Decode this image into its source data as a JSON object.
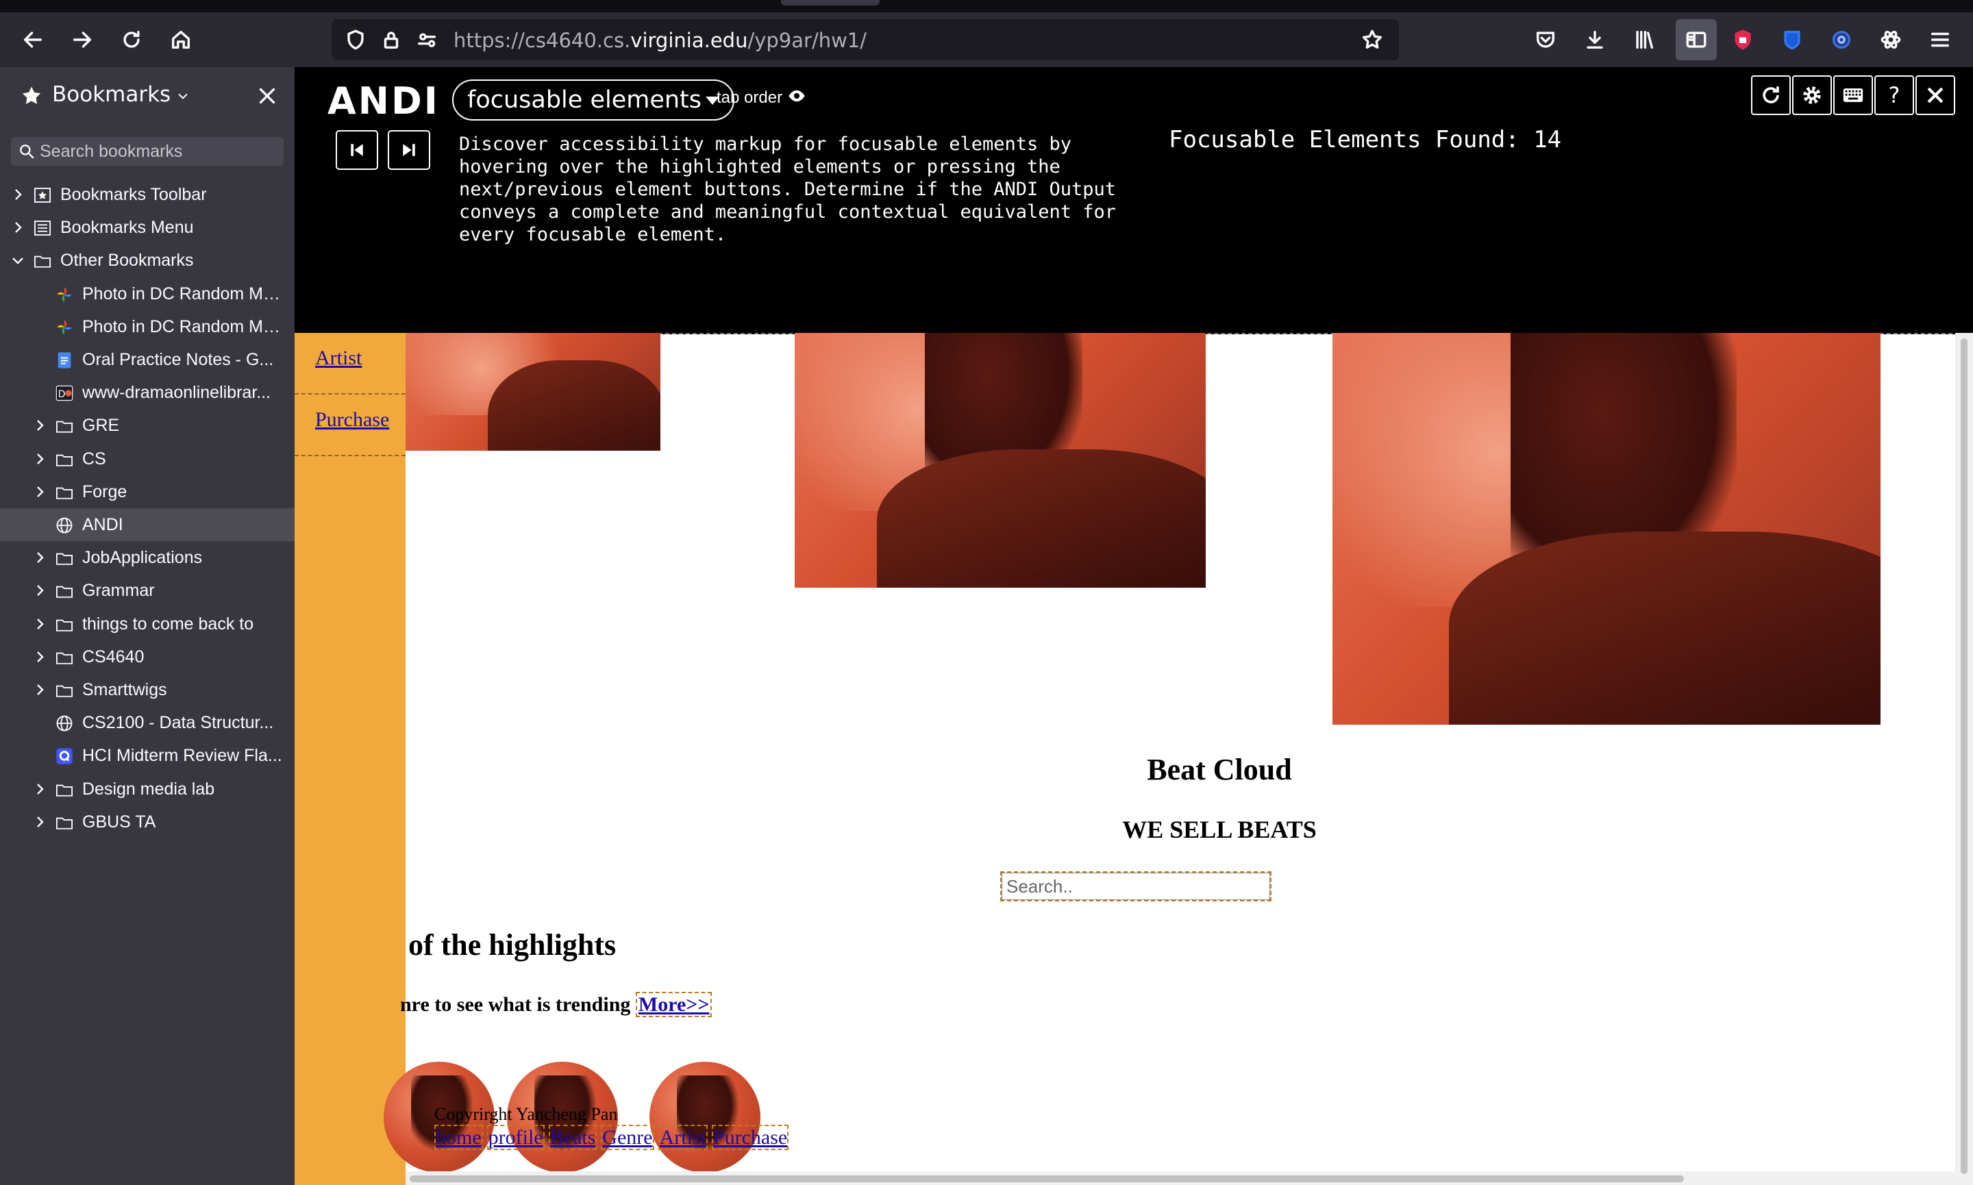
{
  "browser": {
    "url_prefix": "https://cs4640.cs.",
    "url_domain": "virginia.edu",
    "url_path": "/yp9ar/hw1/"
  },
  "sidebar": {
    "title": "Bookmarks",
    "search_placeholder": "Search bookmarks",
    "items": [
      {
        "label": "Bookmarks Toolbar",
        "icon": "star-folder-icon",
        "level": 0,
        "twisty": "right"
      },
      {
        "label": "Bookmarks Menu",
        "icon": "menu-folder-icon",
        "level": 0,
        "twisty": "right"
      },
      {
        "label": "Other Bookmarks",
        "icon": "folder-icon",
        "level": 0,
        "twisty": "down"
      },
      {
        "label": "Photo in DC Random Mo...",
        "icon": "google-photos-icon",
        "level": 1
      },
      {
        "label": "Photo in DC Random Mo...",
        "icon": "google-photos-icon",
        "level": 1
      },
      {
        "label": "Oral Practice Notes - G...",
        "icon": "google-docs-icon",
        "level": 1
      },
      {
        "label": "www-dramaonlinelibrar...",
        "icon": "drama-site-icon",
        "level": 1
      },
      {
        "label": "GRE",
        "icon": "folder-icon",
        "level": 1,
        "twisty": "right"
      },
      {
        "label": "CS",
        "icon": "folder-icon",
        "level": 1,
        "twisty": "right"
      },
      {
        "label": "Forge",
        "icon": "folder-icon",
        "level": 1,
        "twisty": "right"
      },
      {
        "label": "ANDI",
        "icon": "globe-icon",
        "level": 1,
        "selected": true
      },
      {
        "label": "JobApplications",
        "icon": "folder-icon",
        "level": 1,
        "twisty": "right"
      },
      {
        "label": "Grammar",
        "icon": "folder-icon",
        "level": 1,
        "twisty": "right"
      },
      {
        "label": "things to come back to",
        "icon": "folder-icon",
        "level": 1,
        "twisty": "right"
      },
      {
        "label": "CS4640",
        "icon": "folder-icon",
        "level": 1,
        "twisty": "right"
      },
      {
        "label": "Smarttwigs",
        "icon": "folder-icon",
        "level": 1,
        "twisty": "right"
      },
      {
        "label": "CS2100 - Data Structur...",
        "icon": "globe-icon",
        "level": 1
      },
      {
        "label": "HCI Midterm Review Fla...",
        "icon": "quizlet-icon",
        "level": 1
      },
      {
        "label": "Design media lab",
        "icon": "folder-icon",
        "level": 1,
        "twisty": "right"
      },
      {
        "label": "GBUS TA",
        "icon": "folder-icon",
        "level": 1,
        "twisty": "right"
      }
    ]
  },
  "andi": {
    "logo": "ANDI",
    "module": "focusable elements",
    "tab_order": "tab order",
    "description": "Discover accessibility markup for focusable elements by hovering over the highlighted elements or pressing the next/previous element buttons. Determine if the ANDI Output conveys a complete and meaningful contextual equivalent for every focusable element.",
    "count_text": "Focusable Elements Found: 14",
    "help_label": "?"
  },
  "page": {
    "nav_links": [
      "Artist",
      "Purchase"
    ],
    "title": "Beat Cloud",
    "subtitle": "WE SELL BEATS",
    "search_placeholder": "Search..",
    "highlights_title": "of the highlights",
    "trending_text": "nre to see what is trending ",
    "more_link": "More>>",
    "copyright": "Copyrirght Yancheng Pan",
    "footer_links": [
      "home",
      "profile",
      "Beats",
      "Genre",
      "Artist",
      "Purchase"
    ]
  },
  "colors": {
    "nav_background": "#f2a93b",
    "andi_background": "#000000",
    "link": "#1a0dab",
    "sidebar_background": "#38373f",
    "toolbar_background": "#2b2a33"
  }
}
